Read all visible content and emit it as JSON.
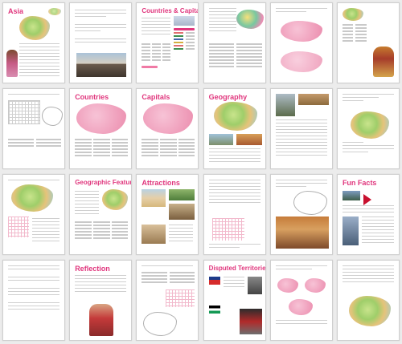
{
  "pages": [
    {
      "title": "Asia",
      "kind": "cover"
    },
    {
      "title": "",
      "kind": "qa"
    },
    {
      "title": "Countries & Capitals",
      "kind": "table"
    },
    {
      "title": "",
      "kind": "map-text"
    },
    {
      "title": "",
      "kind": "map-quiz"
    },
    {
      "title": "",
      "kind": "dancer"
    },
    {
      "title": "",
      "kind": "wordsearch"
    },
    {
      "title": "Countries",
      "kind": "pinkmap"
    },
    {
      "title": "Capitals",
      "kind": "pinkmap"
    },
    {
      "title": "Geography",
      "kind": "geo"
    },
    {
      "title": "",
      "kind": "photos"
    },
    {
      "title": "",
      "kind": "greenmap"
    },
    {
      "title": "",
      "kind": "greenmap-grid"
    },
    {
      "title": "Geographic Features",
      "kind": "features"
    },
    {
      "title": "Attractions",
      "kind": "attractions"
    },
    {
      "title": "",
      "kind": "puzzle"
    },
    {
      "title": "",
      "kind": "city"
    },
    {
      "title": "Fun Facts",
      "kind": "funfacts"
    },
    {
      "title": "",
      "kind": "lines"
    },
    {
      "title": "Reflection",
      "kind": "reflection"
    },
    {
      "title": "",
      "kind": "crossword"
    },
    {
      "title": "Disputed Territories",
      "kind": "disputed"
    },
    {
      "title": "",
      "kind": "quiz"
    },
    {
      "title": "",
      "kind": "final-map"
    }
  ]
}
